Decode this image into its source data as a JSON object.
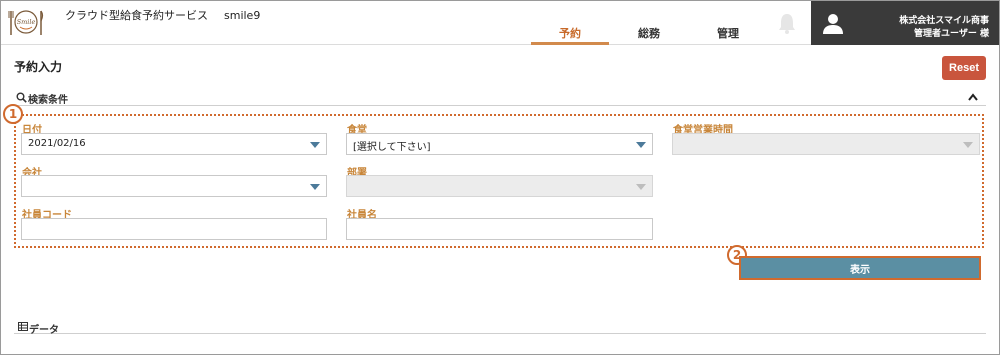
{
  "header": {
    "logo_text": "Smile",
    "app_title": "クラウド型給食予約サービス",
    "system_name": "smile9",
    "tabs": [
      {
        "label": "予約",
        "active": true
      },
      {
        "label": "総務",
        "active": false
      },
      {
        "label": "管理",
        "active": false
      }
    ],
    "company": "株式会社スマイル商事",
    "user": "管理者ユーザー 様"
  },
  "page": {
    "title": "予約入力",
    "reset_label": "Reset"
  },
  "search": {
    "section_label": "検索条件",
    "marker": "1",
    "fields": {
      "date": {
        "label": "日付",
        "value": "2021/02/16"
      },
      "cafeteria": {
        "label": "食堂",
        "value": "[選択して下さい]"
      },
      "hours": {
        "label": "食堂営業時間",
        "value": ""
      },
      "company": {
        "label": "会社",
        "value": ""
      },
      "department": {
        "label": "部署",
        "value": ""
      },
      "employee_code": {
        "label": "社員コード",
        "value": ""
      },
      "employee_name": {
        "label": "社員名",
        "value": ""
      }
    },
    "show_marker": "2",
    "show_label": "表示"
  },
  "data_section": {
    "label": "データ"
  },
  "colors": {
    "accent_orange": "#d06a2e",
    "reset_red": "#c9553d",
    "show_blue": "#5b8fa3",
    "header_dark": "#3a3a3a"
  }
}
